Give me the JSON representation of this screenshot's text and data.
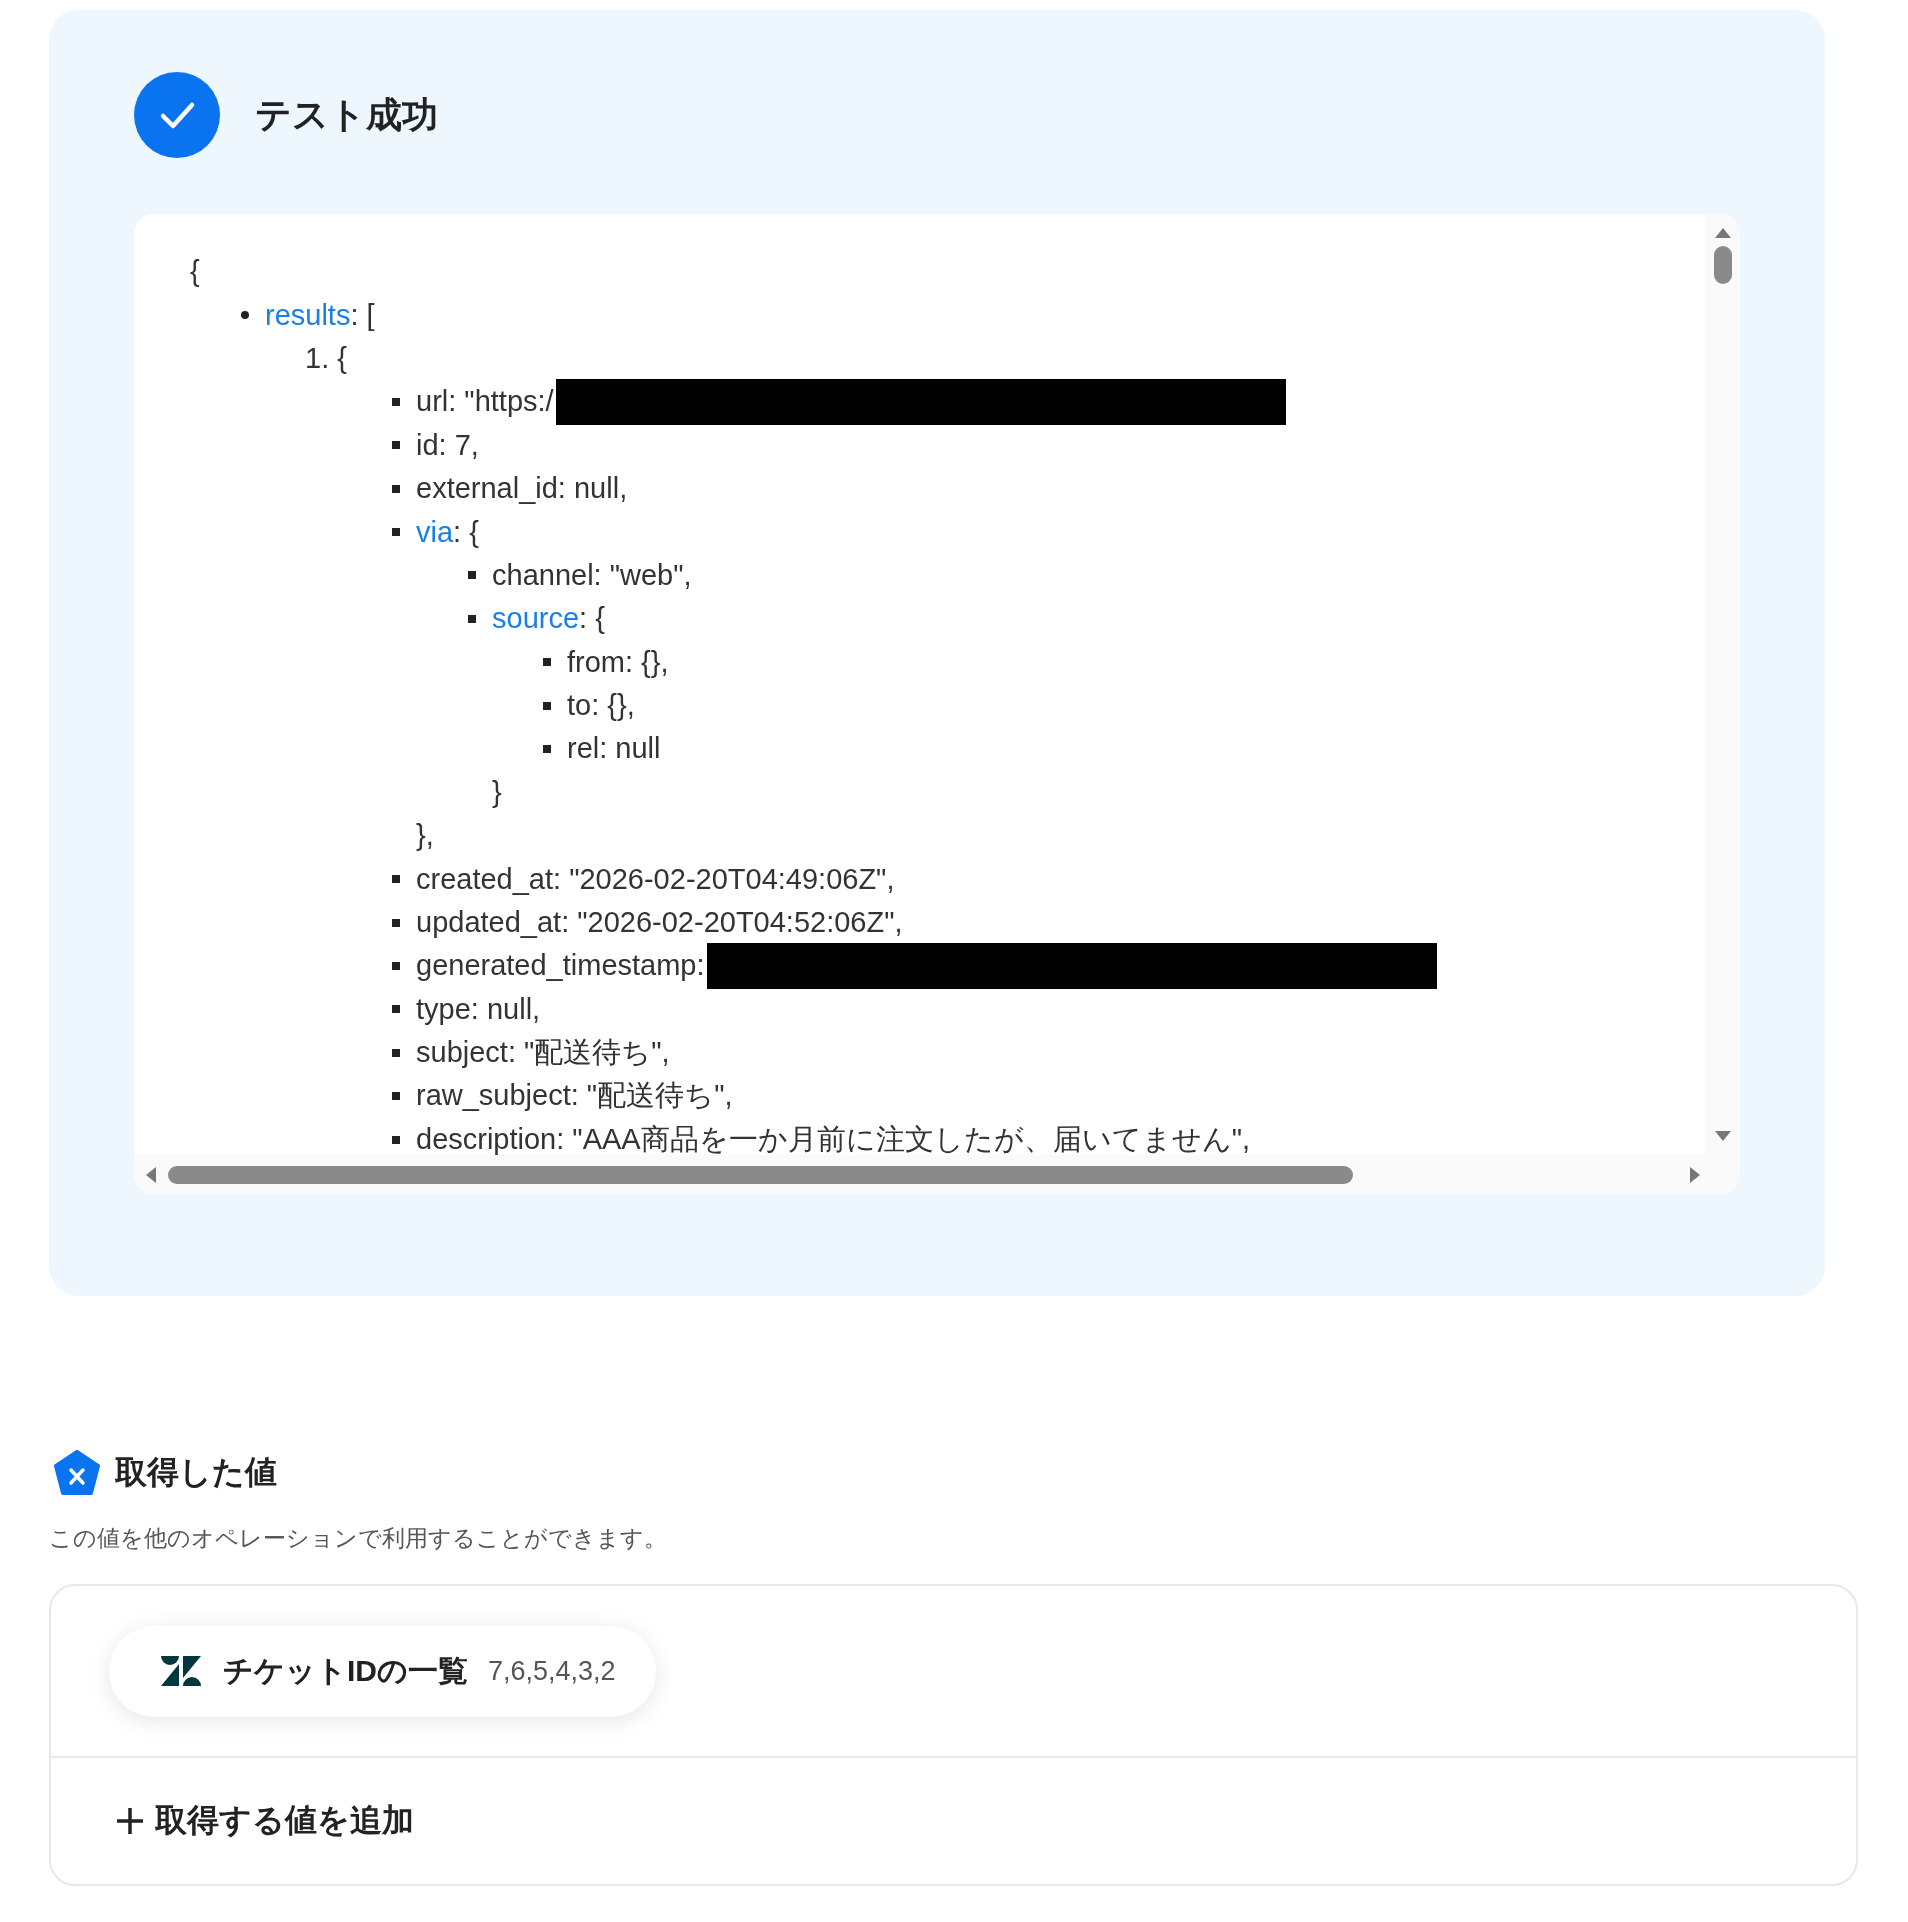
{
  "header": {
    "title": "テスト成功"
  },
  "code": {
    "open": "{",
    "items": [
      {
        "key": "results",
        "rest": ": [",
        "children": [
          {
            "marker": "1.",
            "rest": " {",
            "children": [
              {
                "text": "url: \"https:/",
                "redacted": true
              },
              {
                "text": "id: 7,",
                "redacted": false
              },
              {
                "text": "external_id: null,",
                "redacted": false
              },
              {
                "key": "via",
                "rest": ": {",
                "close": "},",
                "children": [
                  {
                    "text": "channel: \"web\",",
                    "redacted": false
                  },
                  {
                    "key": "source",
                    "rest": ": {",
                    "close": "}",
                    "children": [
                      {
                        "text": "from: {},",
                        "redacted": false
                      },
                      {
                        "text": "to: {},",
                        "redacted": false
                      },
                      {
                        "text": "rel: null",
                        "redacted": false
                      }
                    ]
                  }
                ]
              },
              {
                "text": "created_at: \"2026-02-20T04:49:06Z\",",
                "redacted": false
              },
              {
                "text": "updated_at: \"2026-02-20T04:52:06Z\",",
                "redacted": false
              },
              {
                "text": "generated_timestamp:",
                "redacted": true
              },
              {
                "text": "type: null,",
                "redacted": false
              },
              {
                "text": "subject: \"配送待ち\",",
                "redacted": false
              },
              {
                "text": "raw_subject: \"配送待ち\",",
                "redacted": false
              },
              {
                "text": "description: \"AAA商品を一か月前に注文したが、届いてません\",",
                "redacted": false
              }
            ]
          }
        ]
      }
    ]
  },
  "section": {
    "title": "取得した値",
    "description": "この値を他のオペレーションで利用することができます。"
  },
  "values": [
    {
      "label": "チケットIDの一覧",
      "value": "7,6,5,4,3,2"
    }
  ],
  "add_button": {
    "label": "取得する値を追加"
  }
}
